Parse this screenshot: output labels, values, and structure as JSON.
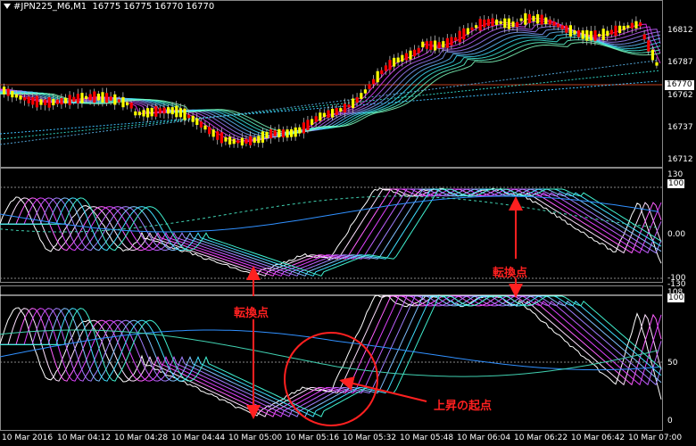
{
  "header": {
    "symbol": "#JPN225_M6,M1",
    "ohlc": "16775 16775 16770 16770"
  },
  "price_axis": [
    "16812",
    "16787",
    "16762",
    "16737",
    "16712"
  ],
  "current_price": "16770",
  "osc1_axis": {
    "top": "130",
    "hundred": "100",
    "zero": "0.00",
    "minus": "-100",
    "bottom": "-130"
  },
  "osc2_axis": {
    "top": "108",
    "hundred": "100",
    "fifty": "50",
    "zero": "0"
  },
  "time_axis": [
    "10 Mar 2016",
    "10 Mar 04:12",
    "10 Mar 04:28",
    "10 Mar 04:44",
    "10 Mar 05:00",
    "10 Mar 05:16",
    "10 Mar 05:32",
    "10 Mar 05:48",
    "10 Mar 06:04",
    "10 Mar 06:22",
    "10 Mar 06:42",
    "10 Mar 07:00"
  ],
  "annotations": {
    "turn1": "転換点",
    "turn2": "転換点",
    "rise": "上昇の起点"
  },
  "colors": {
    "bg": "#000000",
    "bull": "#ffff00",
    "bear": "#ff0000",
    "ma_fast": "#ff30ff",
    "ma_slow": "#40e0ff",
    "annotation": "#ff2020"
  }
}
